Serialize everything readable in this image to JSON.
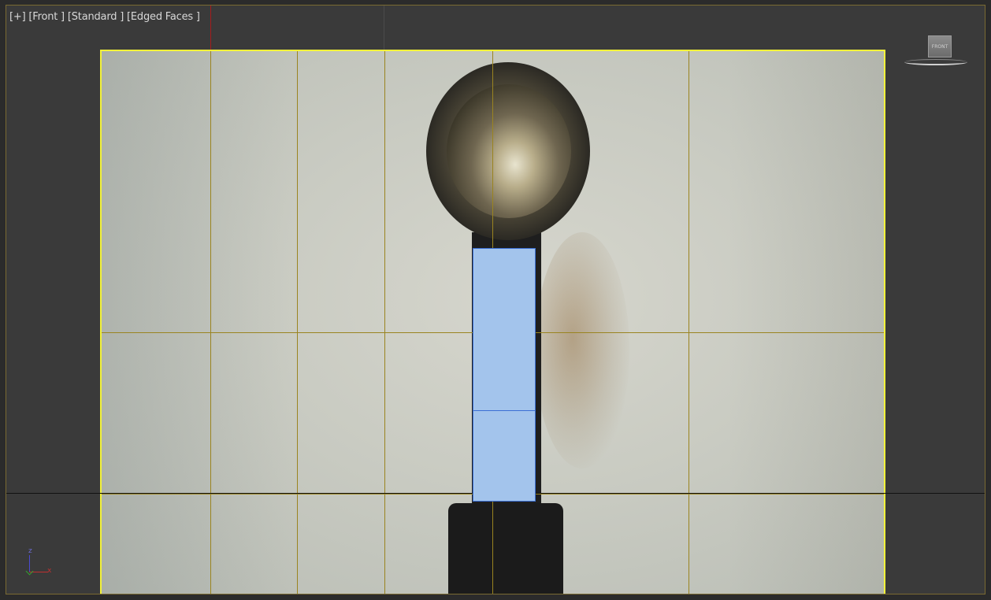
{
  "viewport": {
    "label_plus": "[+]",
    "label_view": "[Front ]",
    "label_shading": "[Standard ]",
    "label_display": "[Edged Faces ]"
  },
  "viewcube": {
    "face_label": "FRONT"
  },
  "axis_gizmo": {
    "z_label": "z",
    "x_label": "x"
  },
  "colors": {
    "frame_border": "#f2f23a",
    "grid_line": "#9a8420",
    "selected_box": "#a3c4ec",
    "box_edge": "#3b6fd4"
  }
}
